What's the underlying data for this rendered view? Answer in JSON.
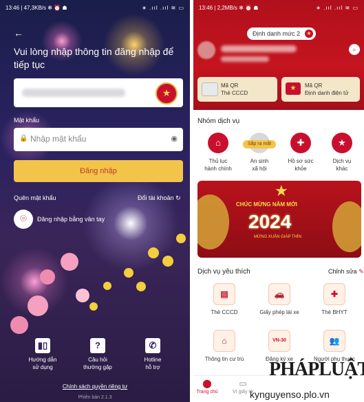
{
  "left": {
    "status": {
      "time": "13:46",
      "speed": "47,3KB/s",
      "icons": "✻ ⏰ ☗",
      "signal": "∗ .ııl .ııl ≋ ▭"
    },
    "back_icon": "←",
    "lead": "Vui lòng nhập thông tin đăng nhập để tiếp tục",
    "password_label": "Mật khẩu",
    "password_placeholder": "Nhập mật khẩu",
    "login_button": "Đăng nhập",
    "forgot_password": "Quên mật khẩu",
    "switch_account": "Đổi tài khoản",
    "fingerprint_login": "Đăng nhập bằng vân tay",
    "bottom": [
      {
        "label": "Hướng dẫn\nsử dụng",
        "icon": "book-icon",
        "glyph": "▮▯"
      },
      {
        "label": "Câu hỏi\nthường gặp",
        "icon": "question-icon",
        "glyph": "?"
      },
      {
        "label": "Hotline\nhỗ trợ",
        "icon": "phone-icon",
        "glyph": "✆"
      }
    ],
    "privacy": "Chính sách quyền riêng tư",
    "version": "Phiên bản 2.1.3",
    "colors": {
      "accent": "#f2c44a",
      "bg": "#2a2260"
    }
  },
  "right": {
    "status": {
      "time": "13:46",
      "speed": "2,2MB/s",
      "icons": "✻ ⏰ ☗",
      "signal": "∗ .ııl .ııl ≋ ▭"
    },
    "id_level": "Định danh mức 2",
    "qr_cards": [
      {
        "line1": "Mã QR",
        "line2": "Thẻ CCCD"
      },
      {
        "line1": "Mã QR",
        "line2": "Định danh điện tử"
      }
    ],
    "service_group_title": "Nhóm dịch vụ",
    "services": [
      {
        "label": "Thủ tục\nhành chính",
        "glyph": "🏛"
      },
      {
        "label": "An sinh\nxã hội",
        "glyph": ""
      },
      {
        "label": "Hồ sơ sức\nkhỏe",
        "glyph": "✚"
      },
      {
        "label": "Dịch vụ\nkhác",
        "glyph": "★"
      }
    ],
    "coming_soon_badge": "Sắp ra mắt",
    "banner": {
      "greeting": "CHÚC MỪNG NĂM MỚI",
      "year": "2024",
      "sub": "MỪNG XUÂN GIÁP THÌN"
    },
    "favorites_title": "Dịch vụ yêu thích",
    "edit_label": "Chỉnh sửa",
    "favorites": [
      {
        "label": "Thẻ CCCD",
        "glyph": "▤"
      },
      {
        "label": "Giấy phép lái xe",
        "glyph": "🚗"
      },
      {
        "label": "Thẻ BHYT",
        "glyph": "✚"
      },
      {
        "label": "Thông tin cư trú",
        "glyph": "⌂"
      },
      {
        "label": "Đăng ký xe",
        "glyph": "VN-30"
      },
      {
        "label": "Người phụ thuộc",
        "glyph": "👥"
      }
    ],
    "tabs": [
      {
        "label": "Trang chủ",
        "glyph": "⬤"
      },
      {
        "label": "Ví giấy tờ",
        "glyph": "▭"
      }
    ],
    "watermark": "PHÁPLUẬT",
    "watermark_site": "kynguyenso.plo.vn",
    "colors": {
      "primary": "#c8102e",
      "gold": "#f2c44a"
    }
  }
}
